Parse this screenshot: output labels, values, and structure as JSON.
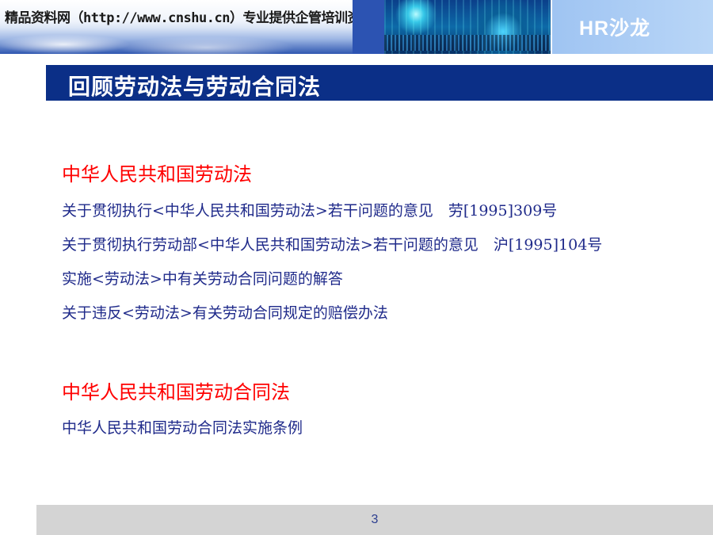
{
  "banner": {
    "site_text": "精品资料网（http://www.cnshu.cn）专业提供企管培训资料",
    "brand": "HR沙龙"
  },
  "title": "回顾劳动法与劳动合同法",
  "sections": [
    {
      "heading": "中华人民共和国劳动法",
      "items": [
        "关于贯彻执行<中华人民共和国劳动法>若干问题的意见　劳[1995]309号",
        "关于贯彻执行劳动部<中华人民共和国劳动法>若干问题的意见　沪[1995]104号",
        "实施<劳动法>中有关劳动合同问题的解答",
        "关于违反<劳动法>有关劳动合同规定的赔偿办法"
      ]
    },
    {
      "heading": "中华人民共和国劳动合同法",
      "items": [
        "中华人民共和国劳动合同法实施条例"
      ]
    }
  ],
  "footer": {
    "page_number": "3"
  },
  "colors": {
    "title_bar": "#0b2f87",
    "heading": "#ff0000",
    "item_text": "#1f2a8a",
    "footer_bg": "#d4d4d4"
  }
}
